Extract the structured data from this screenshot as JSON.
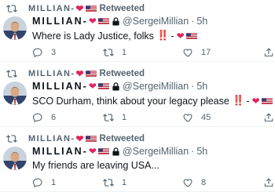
{
  "colors": {
    "muted": "#536471",
    "heart": "#e0245e",
    "text": "#0f1419"
  },
  "tweets": [
    {
      "retweet_user": "MILLIAN-",
      "retweet_label": "Retweeted",
      "display_name": "MILLIAN-",
      "handle": "@SergeiMillian",
      "separator": "·",
      "timestamp": "5h",
      "text": "Where is Lady Justice, folks",
      "text_suffix_bangs": "‼️",
      "text_suffix_dash": "-",
      "reply_count": "3",
      "retweet_count": "1",
      "like_count": "17"
    },
    {
      "retweet_user": "MILLIAN-",
      "retweet_label": "Retweeted",
      "display_name": "MILLIAN-",
      "handle": "@SergeiMillian",
      "separator": "·",
      "timestamp": "5h",
      "text": "SCO Durham, think about your legacy please",
      "text_suffix_bangs": "‼️",
      "text_suffix_dash": "-",
      "reply_count": "6",
      "retweet_count": "1",
      "like_count": "45"
    },
    {
      "retweet_user": "MILLIAN-",
      "retweet_label": "Retweeted",
      "display_name": "MILLIAN-",
      "handle": "@SergeiMillian",
      "separator": "·",
      "timestamp": "5h",
      "text": "My friends are leaving USA...",
      "reply_count": "1",
      "retweet_count": "1",
      "like_count": "8"
    }
  ],
  "icons": {
    "retweet": "retweet-icon",
    "reply": "reply-icon",
    "like": "heart-outline-icon",
    "share": "share-icon",
    "heart": "red-heart-icon",
    "flag": "us-flag-icon",
    "lock": "lock-icon"
  }
}
